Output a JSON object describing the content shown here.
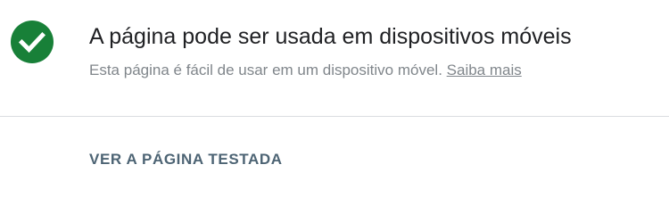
{
  "result": {
    "icon": "check-circle-icon",
    "icon_color": "#188038",
    "title": "A página pode ser usada em dispositivos móveis",
    "description": "Esta página é fácil de usar em um dispositivo móvel.",
    "learn_more": "Saiba mais"
  },
  "actions": {
    "view_tested_page": "VER A PÁGINA TESTADA"
  }
}
